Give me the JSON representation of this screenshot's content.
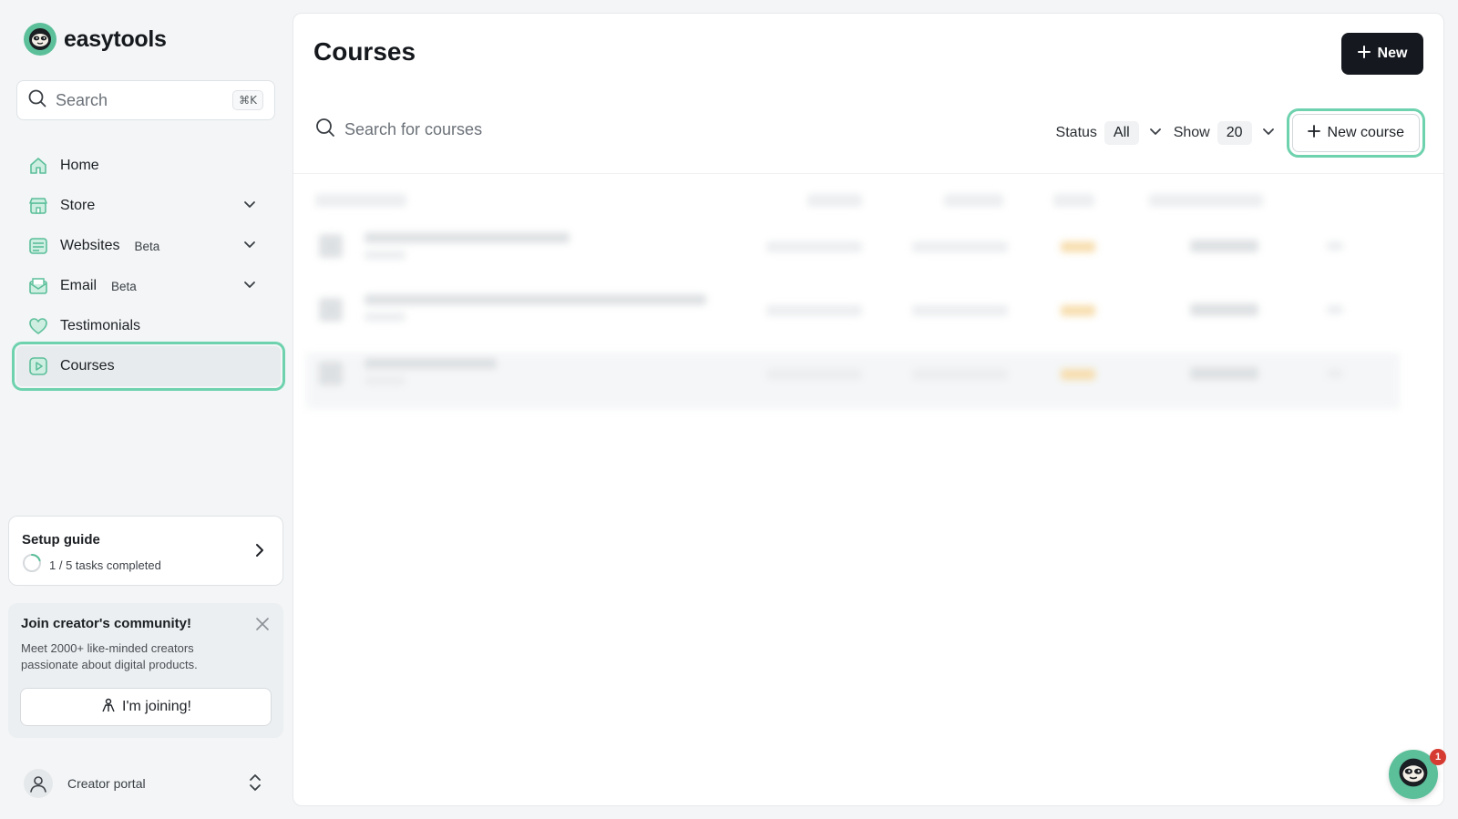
{
  "brand": {
    "name": "easytools"
  },
  "search": {
    "placeholder": "Search",
    "shortcut": "⌘K"
  },
  "sidebar": {
    "items": [
      {
        "label": "Home",
        "icon": "home-icon"
      },
      {
        "label": "Store",
        "icon": "store-icon",
        "expandable": true
      },
      {
        "label": "Websites",
        "badge": "Beta",
        "icon": "website-icon",
        "expandable": true
      },
      {
        "label": "Email",
        "badge": "Beta",
        "icon": "email-icon",
        "expandable": true
      },
      {
        "label": "Testimonials",
        "icon": "heart-icon"
      },
      {
        "label": "Courses",
        "icon": "play-icon",
        "active": true
      }
    ]
  },
  "setup_guide": {
    "title": "Setup guide",
    "progress_text": "1 / 5 tasks completed",
    "completed": 1,
    "total": 5
  },
  "community": {
    "title": "Join creator's community!",
    "description": "Meet 2000+ like-minded creators passionate about digital products.",
    "button": "I'm joining!"
  },
  "portal": {
    "label": "Creator portal"
  },
  "main": {
    "title": "Courses",
    "new_button": "New",
    "search_placeholder": "Search for courses",
    "status_label": "Status",
    "status_value": "All",
    "show_label": "Show",
    "show_value": "20",
    "new_course_button": "New course"
  },
  "chat": {
    "badge_count": "1"
  },
  "colors": {
    "accent": "#5bbf9a",
    "highlight": "#6ed2ae",
    "dark": "#15191f"
  }
}
